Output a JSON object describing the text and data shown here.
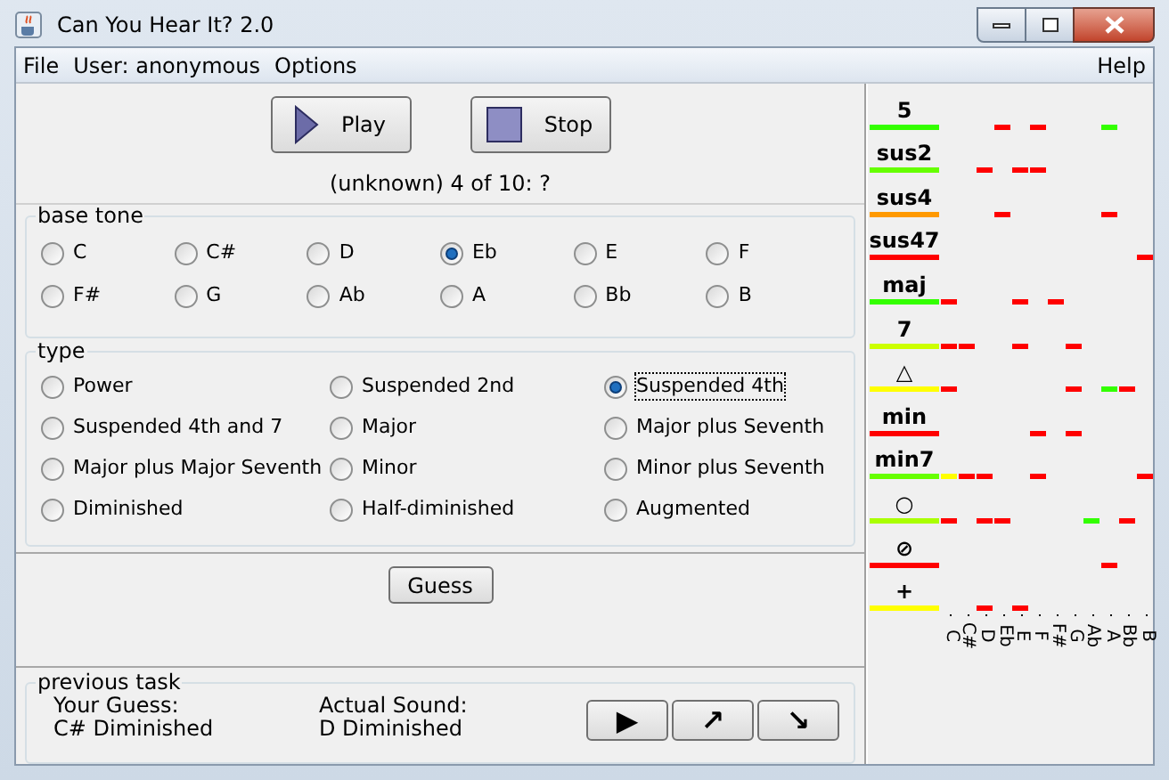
{
  "window": {
    "title": "Can You Hear It? 2.0"
  },
  "menu": {
    "left": [
      {
        "label": "File"
      },
      {
        "label": "User: anonymous"
      },
      {
        "label": "Options"
      }
    ],
    "right": [
      {
        "label": "Help"
      }
    ]
  },
  "player": {
    "buttons": [
      {
        "kind": "play",
        "label": "Play"
      },
      {
        "kind": "stop",
        "label": "Stop"
      }
    ],
    "status": "(unknown) 4 of 10: ?"
  },
  "base_tone": {
    "title": "base tone",
    "options": [
      {
        "label": "C",
        "selected": false
      },
      {
        "label": "C#",
        "selected": false
      },
      {
        "label": "D",
        "selected": false
      },
      {
        "label": "Eb",
        "selected": true
      },
      {
        "label": "E",
        "selected": false
      },
      {
        "label": "F",
        "selected": false
      },
      {
        "label": "F#",
        "selected": false
      },
      {
        "label": "G",
        "selected": false
      },
      {
        "label": "Ab",
        "selected": false
      },
      {
        "label": "A",
        "selected": false
      },
      {
        "label": "Bb",
        "selected": false
      },
      {
        "label": "B",
        "selected": false
      }
    ]
  },
  "type": {
    "title": "type",
    "options": [
      {
        "label": "Power",
        "selected": false,
        "focused": false
      },
      {
        "label": "Suspended 2nd",
        "selected": false,
        "focused": false
      },
      {
        "label": "Suspended 4th",
        "selected": true,
        "focused": true
      },
      {
        "label": "Suspended 4th and 7",
        "selected": false,
        "focused": false
      },
      {
        "label": "Major",
        "selected": false,
        "focused": false
      },
      {
        "label": "Major plus Seventh",
        "selected": false,
        "focused": false
      },
      {
        "label": "Major plus Major Seventh",
        "selected": false,
        "focused": false
      },
      {
        "label": "Minor",
        "selected": false,
        "focused": false
      },
      {
        "label": "Minor plus Seventh",
        "selected": false,
        "focused": false
      },
      {
        "label": "Diminished",
        "selected": false,
        "focused": false
      },
      {
        "label": "Half-diminished",
        "selected": false,
        "focused": false
      },
      {
        "label": "Augmented",
        "selected": false,
        "focused": false
      }
    ]
  },
  "guess_button": "Guess",
  "previous_task": {
    "title": "previous task",
    "your_guess_label": "Your Guess:",
    "your_guess": "C# Diminished",
    "actual_label": "Actual Sound:",
    "actual": "D Diminished",
    "buttons": [
      "▶",
      "↗",
      "↘"
    ]
  },
  "history": {
    "columns": [
      "C",
      "C#",
      "D",
      "Eb",
      "E",
      "F",
      "F#",
      "G",
      "Ab",
      "A",
      "Bb",
      "B"
    ],
    "rows": [
      {
        "label": "5",
        "color": "#33ff00",
        "cells": [
          {
            "marked": false
          },
          {
            "marked": false
          },
          {
            "marked": false
          },
          {
            "marked": true,
            "color": "#ff0000"
          },
          {
            "marked": false
          },
          {
            "marked": true,
            "color": "#ff0000"
          },
          {
            "marked": false
          },
          {
            "marked": false
          },
          {
            "marked": false
          },
          {
            "marked": true,
            "color": "#33ff00"
          },
          {
            "marked": false
          },
          {
            "marked": false
          }
        ]
      },
      {
        "label": "sus2",
        "color": "#66ff00",
        "cells": [
          {
            "marked": false
          },
          {
            "marked": false
          },
          {
            "marked": true,
            "color": "#ff0000"
          },
          {
            "marked": false
          },
          {
            "marked": true,
            "color": "#ff0000"
          },
          {
            "marked": true,
            "color": "#ff0000"
          },
          {
            "marked": false
          },
          {
            "marked": false
          },
          {
            "marked": false
          },
          {
            "marked": false
          },
          {
            "marked": false
          },
          {
            "marked": false
          }
        ]
      },
      {
        "label": "sus4",
        "color": "#ff9900",
        "cells": [
          {
            "marked": false
          },
          {
            "marked": false
          },
          {
            "marked": false
          },
          {
            "marked": true,
            "color": "#ff0000"
          },
          {
            "marked": false
          },
          {
            "marked": false
          },
          {
            "marked": false
          },
          {
            "marked": false
          },
          {
            "marked": false
          },
          {
            "marked": true,
            "color": "#ff0000"
          },
          {
            "marked": false
          },
          {
            "marked": false
          }
        ]
      },
      {
        "label": "sus47",
        "color": "#ff0000",
        "cells": [
          {
            "marked": false
          },
          {
            "marked": false
          },
          {
            "marked": false
          },
          {
            "marked": false
          },
          {
            "marked": false
          },
          {
            "marked": false
          },
          {
            "marked": false
          },
          {
            "marked": false
          },
          {
            "marked": false
          },
          {
            "marked": false
          },
          {
            "marked": false
          },
          {
            "marked": true,
            "color": "#ff0000"
          }
        ]
      },
      {
        "label": "maj",
        "color": "#33ff00",
        "cells": [
          {
            "marked": true,
            "color": "#ff0000"
          },
          {
            "marked": false
          },
          {
            "marked": false
          },
          {
            "marked": false
          },
          {
            "marked": true,
            "color": "#ff0000"
          },
          {
            "marked": false
          },
          {
            "marked": true,
            "color": "#ff0000"
          },
          {
            "marked": false
          },
          {
            "marked": false
          },
          {
            "marked": false
          },
          {
            "marked": false
          },
          {
            "marked": false
          }
        ]
      },
      {
        "label": "7",
        "color": "#ccff00",
        "cells": [
          {
            "marked": true,
            "color": "#ff0000"
          },
          {
            "marked": true,
            "color": "#ff0000"
          },
          {
            "marked": false
          },
          {
            "marked": false
          },
          {
            "marked": true,
            "color": "#ff0000"
          },
          {
            "marked": false
          },
          {
            "marked": false
          },
          {
            "marked": true,
            "color": "#ff0000"
          },
          {
            "marked": false
          },
          {
            "marked": false
          },
          {
            "marked": false
          },
          {
            "marked": false
          }
        ]
      },
      {
        "label": "△",
        "color": "#ffff00",
        "cells": [
          {
            "marked": true,
            "color": "#ff0000"
          },
          {
            "marked": false
          },
          {
            "marked": false
          },
          {
            "marked": false
          },
          {
            "marked": false
          },
          {
            "marked": false
          },
          {
            "marked": false
          },
          {
            "marked": true,
            "color": "#ff0000"
          },
          {
            "marked": false
          },
          {
            "marked": true,
            "color": "#33ff00"
          },
          {
            "marked": true,
            "color": "#ff0000"
          },
          {
            "marked": false
          }
        ]
      },
      {
        "label": "min",
        "color": "#ff0000",
        "cells": [
          {
            "marked": false
          },
          {
            "marked": false
          },
          {
            "marked": false
          },
          {
            "marked": false
          },
          {
            "marked": false
          },
          {
            "marked": true,
            "color": "#ff0000"
          },
          {
            "marked": false
          },
          {
            "marked": true,
            "color": "#ff0000"
          },
          {
            "marked": false
          },
          {
            "marked": false
          },
          {
            "marked": false
          },
          {
            "marked": false
          }
        ]
      },
      {
        "label": "min7",
        "color": "#66ff00",
        "cells": [
          {
            "marked": true,
            "color": "#ffff00"
          },
          {
            "marked": true,
            "color": "#ff0000"
          },
          {
            "marked": true,
            "color": "#ff0000"
          },
          {
            "marked": false
          },
          {
            "marked": false
          },
          {
            "marked": true,
            "color": "#ff0000"
          },
          {
            "marked": false
          },
          {
            "marked": false
          },
          {
            "marked": false
          },
          {
            "marked": false
          },
          {
            "marked": false
          },
          {
            "marked": true,
            "color": "#ff0000"
          }
        ]
      },
      {
        "label": "○",
        "color": "#aaff00",
        "cells": [
          {
            "marked": true,
            "color": "#ff0000"
          },
          {
            "marked": false
          },
          {
            "marked": true,
            "color": "#ff0000"
          },
          {
            "marked": true,
            "color": "#ff0000"
          },
          {
            "marked": false
          },
          {
            "marked": false
          },
          {
            "marked": false
          },
          {
            "marked": false
          },
          {
            "marked": true,
            "color": "#33ff00"
          },
          {
            "marked": false
          },
          {
            "marked": true,
            "color": "#ff0000"
          },
          {
            "marked": false
          }
        ]
      },
      {
        "label": "⊘",
        "color": "#ff0000",
        "cells": [
          {
            "marked": false
          },
          {
            "marked": false
          },
          {
            "marked": false
          },
          {
            "marked": false
          },
          {
            "marked": false
          },
          {
            "marked": false
          },
          {
            "marked": false
          },
          {
            "marked": false
          },
          {
            "marked": false
          },
          {
            "marked": true,
            "color": "#ff0000"
          },
          {
            "marked": false
          },
          {
            "marked": false
          }
        ]
      },
      {
        "label": "+",
        "color": "#ffff00",
        "cells": [
          {
            "marked": false
          },
          {
            "marked": false
          },
          {
            "marked": true,
            "color": "#ff0000"
          },
          {
            "marked": false
          },
          {
            "marked": true,
            "color": "#ff0000"
          },
          {
            "marked": false
          },
          {
            "marked": false
          },
          {
            "marked": false
          },
          {
            "marked": false
          },
          {
            "marked": false
          },
          {
            "marked": false
          },
          {
            "marked": false
          }
        ]
      }
    ]
  }
}
